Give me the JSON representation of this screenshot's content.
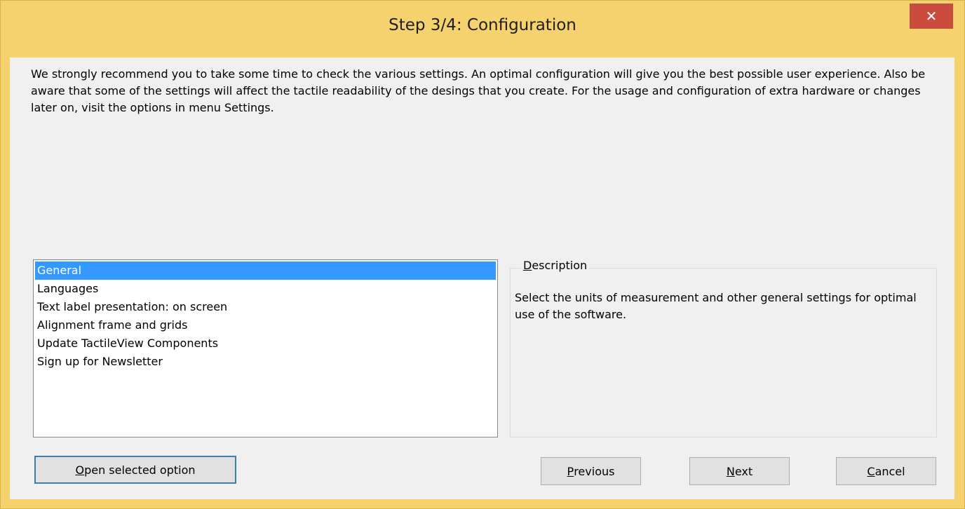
{
  "window": {
    "title": "Step 3/4: Configuration",
    "close_glyph": "✕"
  },
  "intro_text": "We strongly recommend you to take some time to check the various settings. An optimal configuration will give you the best possible user experience. Also be aware that some of the settings will affect the tactile readability of the desings that you create. For the usage and configuration of extra hardware or changes later on, visit the options in menu Settings.",
  "options_list": {
    "items": [
      {
        "label": "General",
        "selected": true
      },
      {
        "label": "Languages",
        "selected": false
      },
      {
        "label": "Text label presentation: on screen",
        "selected": false
      },
      {
        "label": "Alignment frame and grids",
        "selected": false
      },
      {
        "label": "Update TactileView Components",
        "selected": false
      },
      {
        "label": "Sign up for Newsletter",
        "selected": false
      }
    ]
  },
  "description": {
    "title_accel": "D",
    "title_rest": "escription",
    "text": "Select the units of measurement and other general settings for optimal use of the software."
  },
  "buttons": {
    "open_accel": "O",
    "open_rest": "pen selected option",
    "previous_accel": "P",
    "previous_rest": "revious",
    "next_accel": "N",
    "next_rest": "ext",
    "cancel_accel": "C",
    "cancel_rest": "ancel"
  },
  "colors": {
    "titlebar": "#f5d26d",
    "close_button": "#c94c3e",
    "selection": "#3399ff",
    "client_bg": "#f0f0f0"
  }
}
